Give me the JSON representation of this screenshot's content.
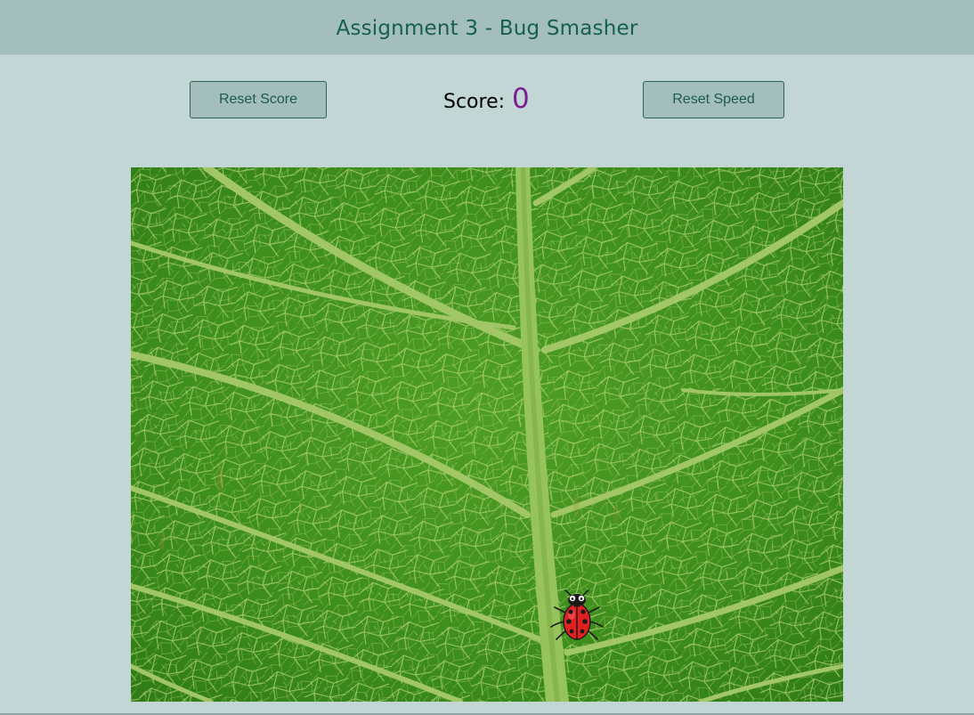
{
  "header": {
    "title": "Assignment 3 - Bug Smasher"
  },
  "controls": {
    "reset_score_label": "Reset Score",
    "reset_speed_label": "Reset Speed",
    "score_label": "Score:",
    "score_value": "0"
  },
  "game": {
    "background": "leaf-texture",
    "sprite": "ladybug-icon"
  },
  "colors": {
    "header_bg": "#a3bebb",
    "page_bg": "#c2d6d5",
    "title_text": "#15604f",
    "score_value": "#7a1e92",
    "button_border": "#2f6156"
  }
}
